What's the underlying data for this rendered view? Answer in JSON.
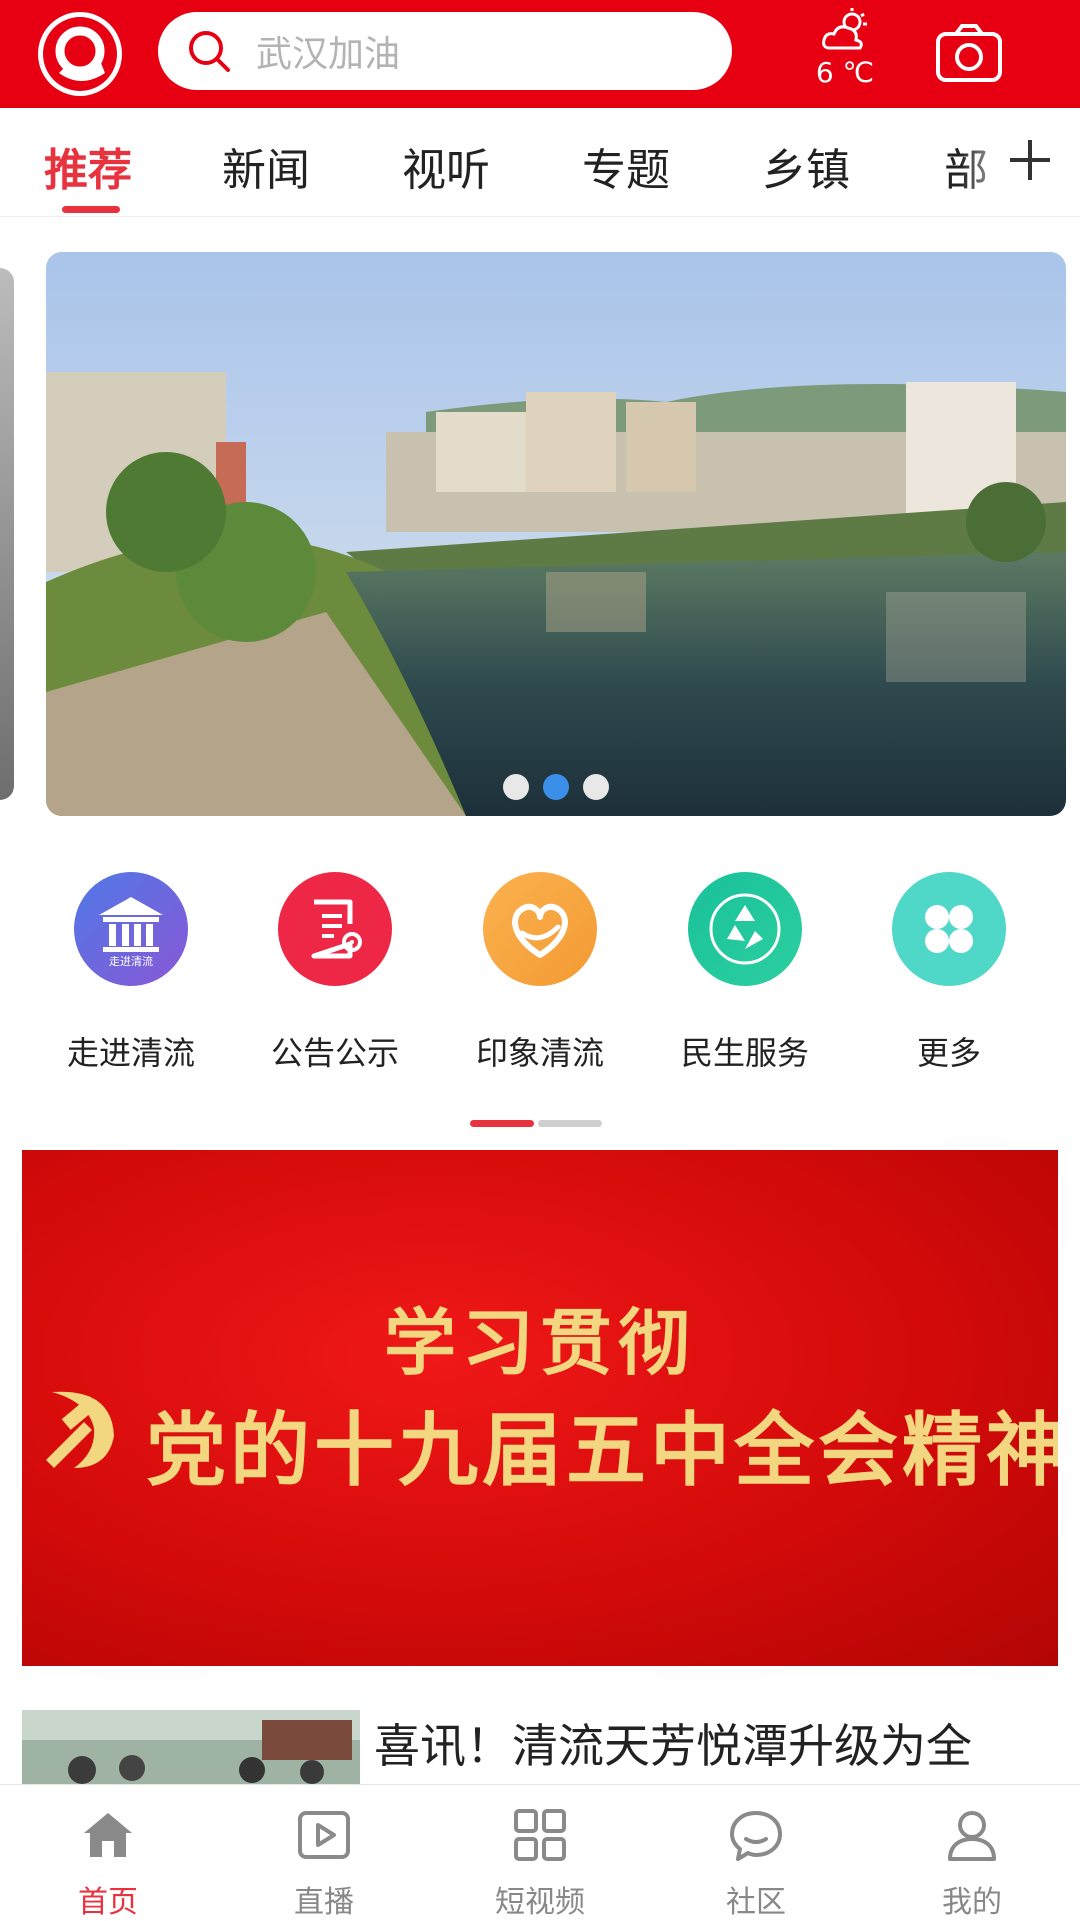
{
  "header": {
    "search_placeholder": "武汉加油",
    "weather_temp": "6 ℃",
    "colors": {
      "brand": "#e60012"
    }
  },
  "tabs": {
    "items": [
      "推荐",
      "新闻",
      "视听",
      "专题",
      "乡镇",
      "部"
    ],
    "active_index": 0
  },
  "banner": {
    "slide_count": 3,
    "active_slide": 1
  },
  "quick_links": [
    {
      "label": "走进清流",
      "icon": "museum-icon",
      "color": "#6a63dc",
      "badge": "走进清流"
    },
    {
      "label": "公告公示",
      "icon": "document-icon",
      "color": "#ee2747"
    },
    {
      "label": "印象清流",
      "icon": "heart-icon",
      "color": "#f7a640"
    },
    {
      "label": "民生服务",
      "icon": "recycle-icon",
      "color": "#22c39a"
    },
    {
      "label": "更多",
      "icon": "grid-icon",
      "color": "#4fd7c8"
    }
  ],
  "promo": {
    "line1": "学习贯彻",
    "line2": "党的十九届五中全会精神"
  },
  "news": [
    {
      "title": "喜讯！清流天芳悦潭升级为全"
    }
  ],
  "bottom_nav": [
    {
      "label": "首页",
      "icon": "home-icon",
      "active": true
    },
    {
      "label": "直播",
      "icon": "play-icon",
      "active": false
    },
    {
      "label": "短视频",
      "icon": "grid-icon",
      "active": false
    },
    {
      "label": "社区",
      "icon": "chat-icon",
      "active": false
    },
    {
      "label": "我的",
      "icon": "user-icon",
      "active": false
    }
  ]
}
